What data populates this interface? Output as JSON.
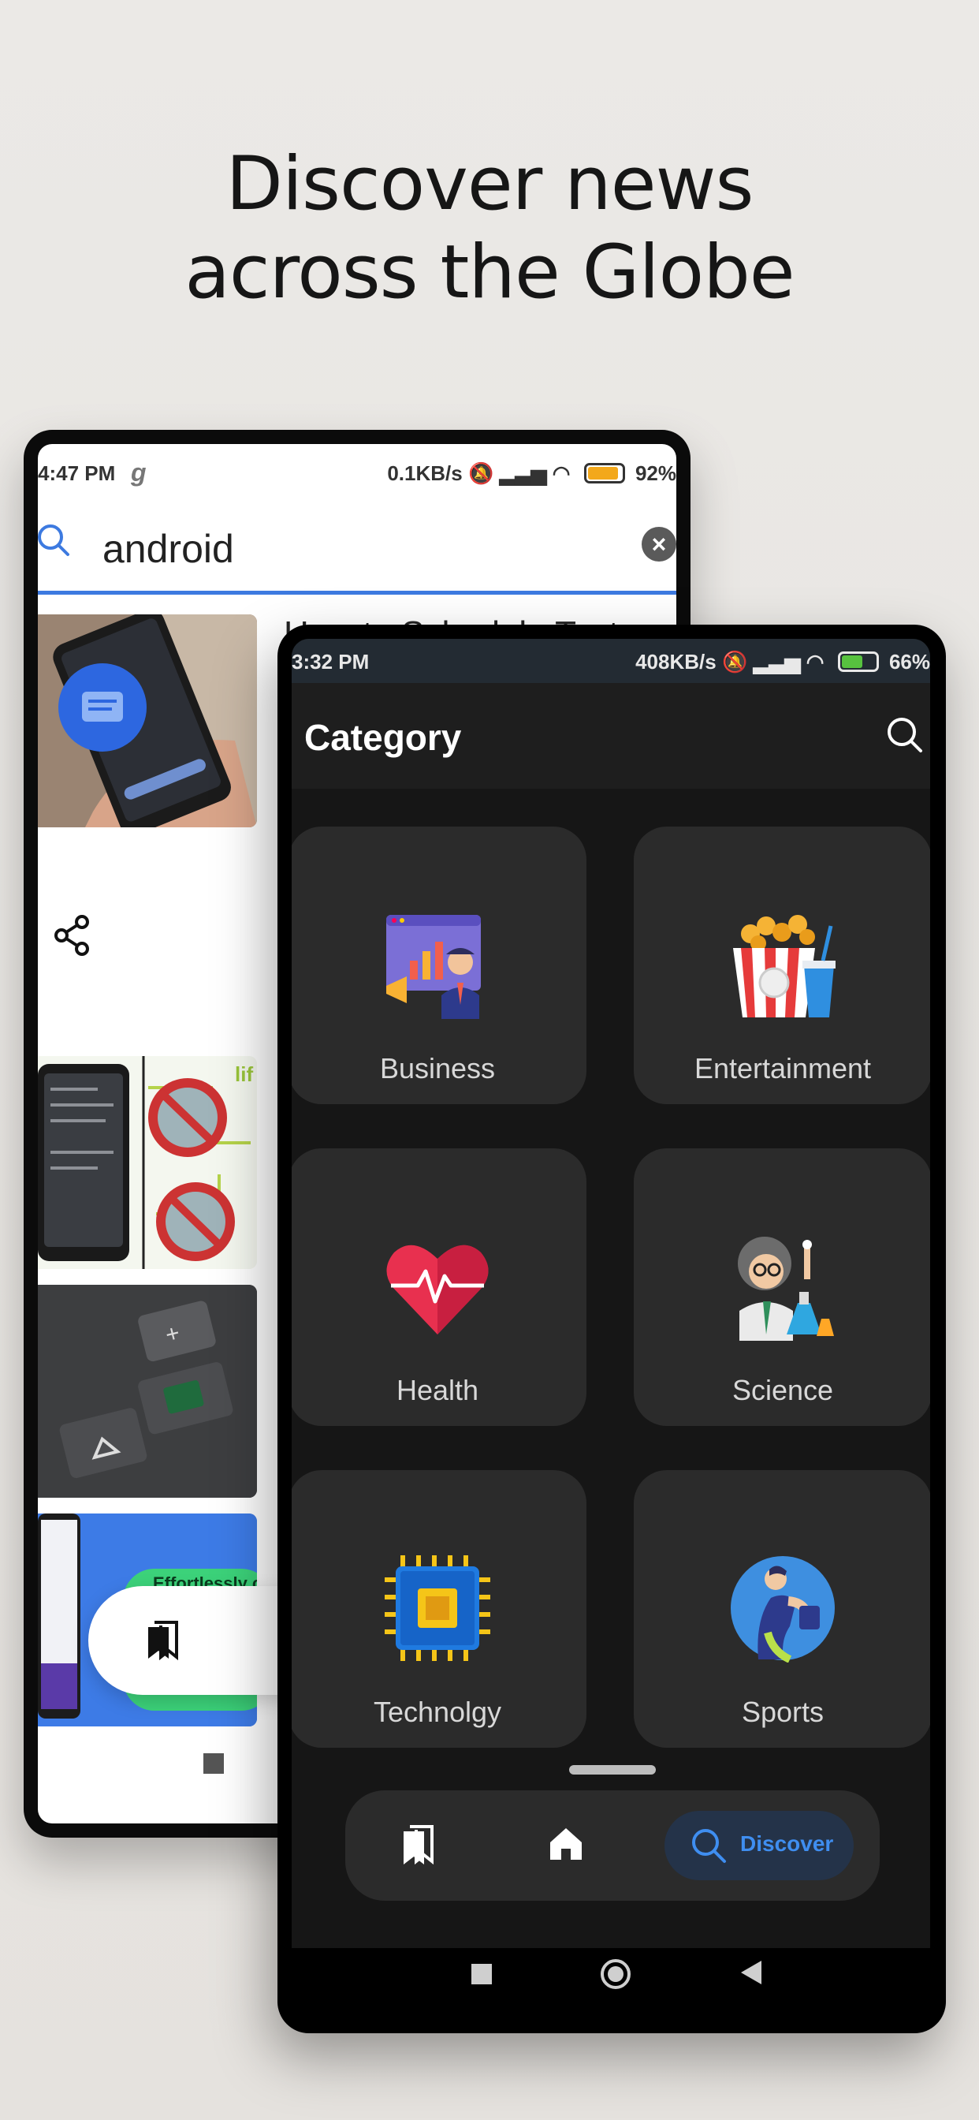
{
  "headline": {
    "line1": "Discover news",
    "line2": "across the Globe"
  },
  "back_phone": {
    "status": {
      "time": "4:47 PM",
      "carrier_glyph": "g",
      "right": "0.1KB/s",
      "network": "4G",
      "battery": "92%"
    },
    "search": {
      "value": "android",
      "clear_icon": "close-icon",
      "search_icon": "search-icon"
    },
    "first_card_title": "How to Schedule Text",
    "thumb_texts": {
      "lifehacker": "lif",
      "effortlessly": "Effortlessly c"
    },
    "save_fab_icon": "bookmarks-icon"
  },
  "front_phone": {
    "status": {
      "time": "3:32 PM",
      "speed": "408KB/s",
      "network": "4G",
      "battery": "66%"
    },
    "appbar": {
      "title": "Category",
      "search_icon": "search-icon"
    },
    "categories": [
      {
        "label": "Business",
        "icon": "business-presentation-icon"
      },
      {
        "label": "Entertainment",
        "icon": "popcorn-icon"
      },
      {
        "label": "Health",
        "icon": "heartbeat-icon"
      },
      {
        "label": "Science",
        "icon": "scientist-icon"
      },
      {
        "label": "Technolgy",
        "icon": "microchip-icon"
      },
      {
        "label": "Sports",
        "icon": "weightlifter-icon"
      }
    ],
    "bottom_nav": {
      "items": [
        {
          "icon": "bookmarks-icon",
          "label": ""
        },
        {
          "icon": "home-icon",
          "label": ""
        },
        {
          "icon": "search-icon",
          "label": "Discover",
          "active": true
        }
      ],
      "accent": "#3f8ef0"
    }
  }
}
